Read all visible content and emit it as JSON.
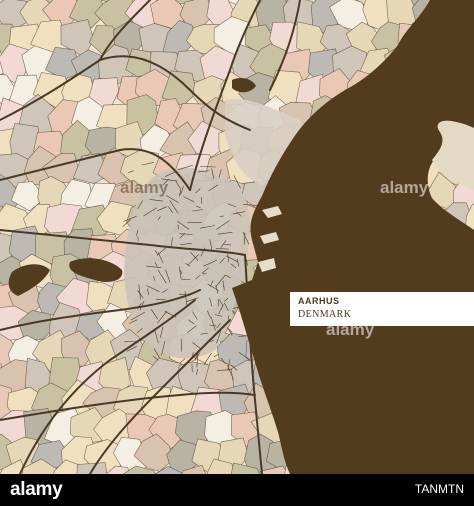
{
  "map": {
    "city": "AARHUS",
    "country": "DENMARK",
    "colors": {
      "water": "#533b1e",
      "land_base": "#efe6d2",
      "roads": "#4a3a25",
      "label_box": "#ffffff",
      "patches": [
        "#f3d9d4",
        "#e6d8b6",
        "#c9c2a2",
        "#b8b3a2",
        "#d9c3ae",
        "#f4efe2",
        "#cfc6b9",
        "#e9c9b6",
        "#bdb9b4",
        "#f0e0c0"
      ]
    }
  },
  "watermark": {
    "logo": "alamy",
    "image_id": "TANMTN",
    "overlay_marks": [
      "alamy",
      "alamy",
      "alamy"
    ]
  }
}
